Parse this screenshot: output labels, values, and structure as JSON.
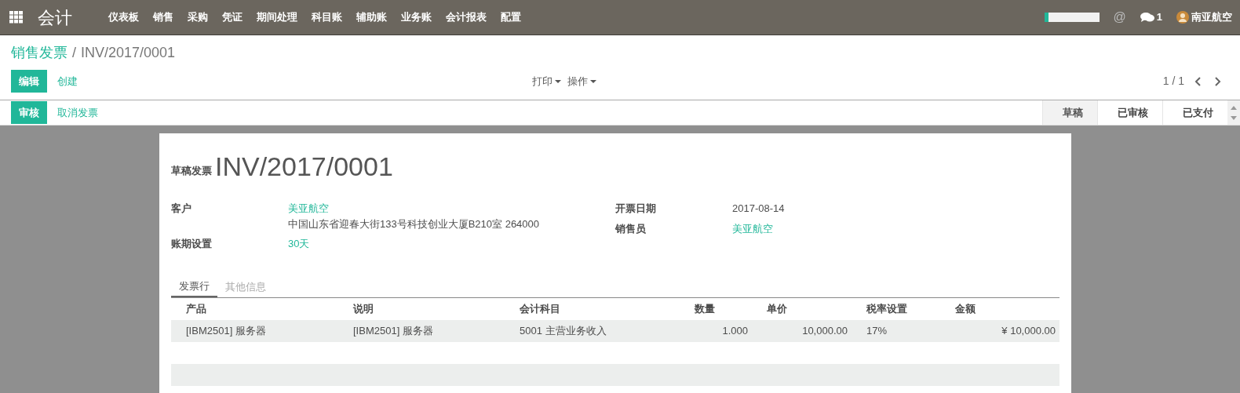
{
  "navbar": {
    "app_name": "会计",
    "menu": [
      "仪表板",
      "销售",
      "采购",
      "凭证",
      "期间处理",
      "科目账",
      "辅助账",
      "业务账",
      "会计报表",
      "配置"
    ],
    "systray": {
      "meter": {
        "level": 0.08
      },
      "at_sign": "@",
      "messages": "1",
      "user": "南亚航空"
    }
  },
  "breadcrumb": {
    "parent": "销售发票",
    "separator": "/",
    "current": "INV/2017/0001"
  },
  "control_panel": {
    "buttons": [
      {
        "label": "编辑",
        "kind": "primary"
      },
      {
        "label": "创建",
        "kind": "link"
      }
    ],
    "dropdowns": [
      "打印",
      "操作"
    ],
    "pager": "1 / 1"
  },
  "status_bar": {
    "buttons": [
      {
        "label": "审核",
        "kind": "primary"
      },
      {
        "label": "取消发票",
        "kind": "link"
      }
    ],
    "stages": [
      {
        "label": "草稿",
        "selected": true
      },
      {
        "label": "已审核",
        "selected": false
      },
      {
        "label": "已支付",
        "selected": false
      }
    ]
  },
  "sheet": {
    "state_label": "草稿发票",
    "number": "INV/2017/0001",
    "left_fields": [
      {
        "label": "客户",
        "value": "美亚航空",
        "link": true,
        "extra": "中国山东省迎春大街133号科技创业大厦B210室 264000"
      },
      {
        "label": "账期设置",
        "value": "30天",
        "link": true
      }
    ],
    "right_fields": [
      {
        "label": "开票日期",
        "value": "2017-08-14",
        "link": false
      },
      {
        "label": "销售员",
        "value": "美亚航空",
        "link": true
      }
    ],
    "tabs": [
      {
        "label": "发票行",
        "selected": true
      },
      {
        "label": "其他信息",
        "selected": false
      }
    ],
    "table": {
      "columns": [
        "产品",
        "说明",
        "会计科目",
        "数量",
        "单价",
        "税率设置",
        "金额"
      ],
      "rows": [
        [
          "[IBM2501] 服务器",
          "[IBM2501] 服务器",
          "5001 主营业务收入",
          "1.000",
          "10,000.00",
          "17%",
          "¥ 10,000.00"
        ]
      ]
    }
  }
}
